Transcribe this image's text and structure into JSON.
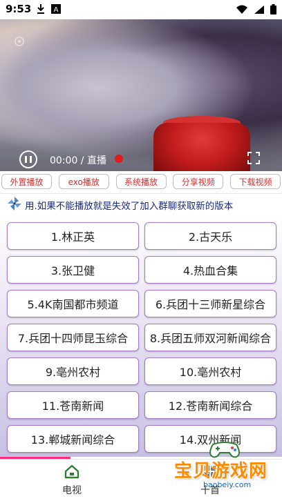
{
  "status_bar": {
    "time": "9:53",
    "icons_left": [
      "download-icon",
      "a-badge-icon"
    ],
    "icons_right": [
      "wifi-icon",
      "signal-icon",
      "battery-icon"
    ]
  },
  "video": {
    "time_label": "00:00 / 直播",
    "state": "paused"
  },
  "engines": [
    {
      "label": "外置播放"
    },
    {
      "label": "exo播放"
    },
    {
      "label": "系统播放"
    },
    {
      "label": "分享视频"
    },
    {
      "label": "下载视频"
    }
  ],
  "marquee": {
    "text": "用.如果不能播放就是失效了加入群聊获取新的版本"
  },
  "channels": [
    "1.林正英",
    "2.古天乐",
    "3.张卫健",
    "4.热血合集",
    "5.4K南国都市频道",
    "6.兵团十三师新星综合",
    "7.兵团十四师昆玉综合",
    "8.兵团五师双河新闻综合",
    "9.亳州农村",
    "10.亳州农村",
    "11.苍南新闻",
    "12.苍南新闻综合",
    "13.郸城新闻综合",
    "14.双州新闻"
  ],
  "tabs": [
    {
      "label": "电视",
      "icon": "home-icon",
      "active": true
    },
    {
      "label": "十首",
      "icon": "grid-icon",
      "active": false
    }
  ],
  "brand": {
    "title": "宝贝游戏网",
    "url": "baobeiy.com"
  },
  "colors": {
    "engine_text": "#d32f2f",
    "channel_border": "#a678c8",
    "accent_pink": "#ff2d7a",
    "marquee_text": "#1a2a7a"
  }
}
